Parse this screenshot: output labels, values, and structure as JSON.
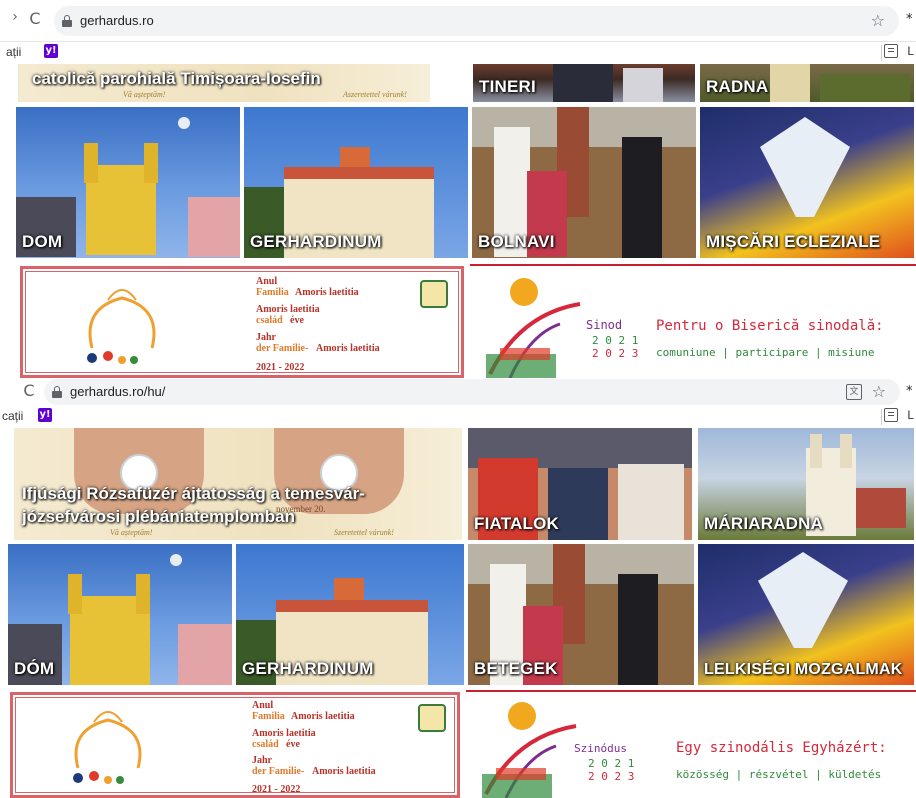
{
  "colors": {
    "accent_red": "#c8202e",
    "amoris_pink": "#d8646a",
    "sinod_purple": "#7c2d8e",
    "sinod_green": "#2f8a3c",
    "sinod_red": "#d6283a"
  },
  "screenshot1": {
    "toolbar": {
      "reload_icon": "C",
      "url": "gerhardus.ro",
      "star_icon": "☆",
      "right_fragment": "*"
    },
    "bookmarks": {
      "left_text": "ații",
      "yahoo_icon": "y!",
      "right_text": "L"
    },
    "hero_caption": "catolică parohială Timișoara-Iosefin",
    "hero_small_1": "Vă așteptăm!",
    "hero_small_2": "Aszeretettel várunk!",
    "tiles": [
      {
        "label": "TINERI"
      },
      {
        "label": "RADNA"
      },
      {
        "label": "DOM"
      },
      {
        "label": "GERHARDINUM"
      },
      {
        "label": "BOLNAVI"
      },
      {
        "label": "MIȘCĂRI ECLEZIALE"
      }
    ],
    "amoris": {
      "l1": "Anul",
      "l2a": "Familia",
      "l2b": "Amoris laetitia",
      "l3": "Amoris laetitia",
      "l4a": "család",
      "l4b": "éve",
      "l5": "Jahr",
      "l6a": "der Familie-",
      "l6b": "Amoris laetitia",
      "years": "2021 - 2022"
    },
    "sinod": {
      "word": "Sinod",
      "year1": "2 0 2 1",
      "year2": "2 0 2 3",
      "title": "Pentru o Biserică sinodală:",
      "subtitle": "comuniune | participare | misiune"
    }
  },
  "screenshot2": {
    "toolbar": {
      "reload_icon": "C",
      "url": "gerhardus.ro/hu/",
      "translate_icon": "文",
      "star_icon": "☆",
      "right_fragment": "*"
    },
    "bookmarks": {
      "left_text": "cații",
      "yahoo_icon": "y!",
      "right_text": "L"
    },
    "hero_caption_1": "Ifjúsági Rózsafüzér ájtatosság a temesvár-",
    "hero_caption_2": "józsefvárosi plébániatemplomban",
    "hero_small_1": "Vă așteptăm!",
    "hero_small_2": "Szeretettel várunk!",
    "hero_date": "november 20.",
    "tiles": [
      {
        "label": "FIATALOK"
      },
      {
        "label": "MÁRIARADNA"
      },
      {
        "label": "DÓM"
      },
      {
        "label": "GERHARDINUM"
      },
      {
        "label": "BETEGEK"
      },
      {
        "label": "LELKISÉGI MOZGALMAK"
      }
    ],
    "amoris": {
      "l1": "Anul",
      "l2a": "Familia",
      "l2b": "Amoris laetitia",
      "l3": "Amoris laetitia",
      "l4a": "család",
      "l4b": "éve",
      "l5": "Jahr",
      "l6a": "der Familie-",
      "l6b": "Amoris laetitia",
      "years": "2021 - 2022"
    },
    "sinod": {
      "word": "Szinódus",
      "year1": "2 0 2 1",
      "year2": "2 0 2 3",
      "title": "Egy szinodális Egyházért:",
      "subtitle": "közösség | részvétel | küldetés"
    }
  }
}
